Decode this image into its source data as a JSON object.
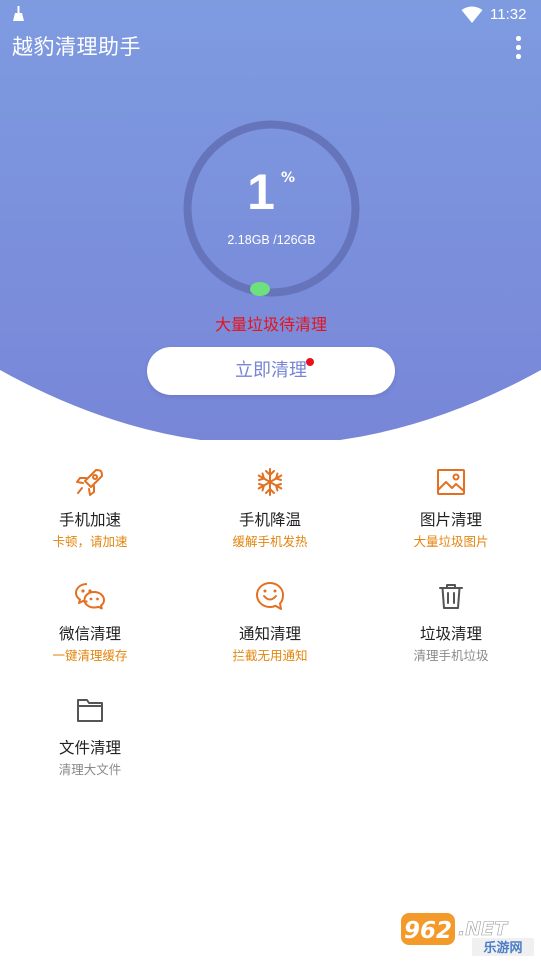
{
  "status_bar": {
    "time": "11:32",
    "icons": [
      "broom-icon",
      "wifi-icon"
    ]
  },
  "app": {
    "title": "越豹清理助手",
    "menu_icon": "more-vertical-icon"
  },
  "colors": {
    "hero_top": "#7e9be0",
    "hero_bottom": "#7886d8",
    "ring_track": "#6674bc",
    "ring_progress": "#6ee07e",
    "warning": "#e8121c",
    "button_text": "#7685d6",
    "accent_orange": "#e3850f",
    "icon_orange": "#e37022",
    "muted_grey": "#8a8a8a"
  },
  "usage": {
    "percent": "1",
    "percent_symbol": "%",
    "storage": "2.18GB /126GB",
    "used_fraction": 0.01
  },
  "warning_text": "大量垃圾待清理",
  "clean_button": {
    "label": "立即清理",
    "has_notification_dot": true
  },
  "features": [
    {
      "name": "手机加速",
      "subtitle": "卡顿，请加速",
      "icon": "rocket-icon",
      "subtitle_color": "orange"
    },
    {
      "name": "手机降温",
      "subtitle": "缓解手机发热",
      "icon": "snowflake-icon",
      "subtitle_color": "orange"
    },
    {
      "name": "图片清理",
      "subtitle": "大量垃圾图片",
      "icon": "image-icon",
      "subtitle_color": "orange"
    },
    {
      "name": "微信清理",
      "subtitle": "一键清理缓存",
      "icon": "wechat-icon",
      "subtitle_color": "orange"
    },
    {
      "name": "通知清理",
      "subtitle": "拦截无用通知",
      "icon": "smile-chat-icon",
      "subtitle_color": "orange"
    },
    {
      "name": "垃圾清理",
      "subtitle": "清理手机垃圾",
      "icon": "trash-icon",
      "subtitle_color": "grey"
    },
    {
      "name": "文件清理",
      "subtitle": "清理大文件",
      "icon": "folder-icon",
      "subtitle_color": "grey"
    }
  ],
  "watermark": {
    "number": "962",
    "suffix": ".NET",
    "text": "乐游网"
  }
}
